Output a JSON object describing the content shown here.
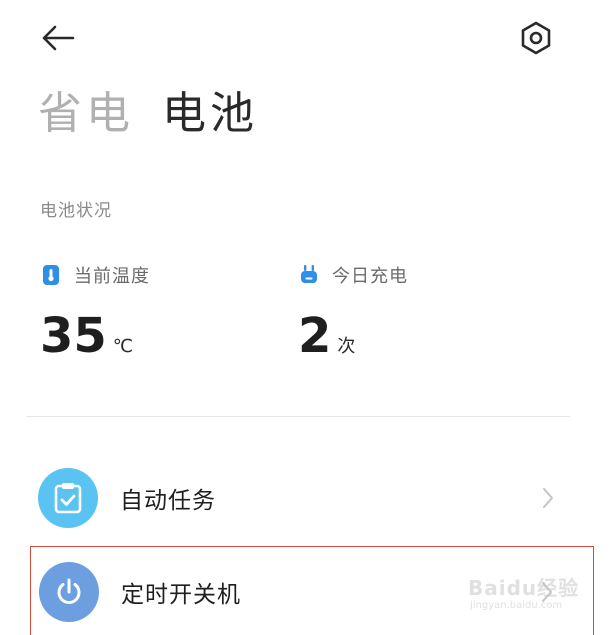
{
  "header": {
    "back_icon": "arrow-left-icon",
    "settings_icon": "hexagon-gear-icon"
  },
  "tabs": [
    {
      "label": "省电",
      "active": false
    },
    {
      "label": "电池",
      "active": true
    }
  ],
  "battery_status": {
    "section_title": "电池状况",
    "temperature": {
      "label": "当前温度",
      "value": "35",
      "unit": "℃",
      "icon": "thermometer-icon",
      "icon_color": "#2f8fe8"
    },
    "charges_today": {
      "label": "今日充电",
      "value": "2",
      "unit": "次",
      "icon": "plug-icon",
      "icon_color": "#2f8fe8"
    }
  },
  "menu": [
    {
      "label": "自动任务",
      "icon": "clipboard-check-icon",
      "icon_bg": "#5bc3f2"
    },
    {
      "label": "定时开关机",
      "icon": "power-icon",
      "icon_bg": "#6d9fe0"
    }
  ],
  "watermark": {
    "text": "Baidu经验",
    "sub": "jingyan.baidu.com"
  },
  "colors": {
    "highlight_border": "#d24a3c",
    "inactive_tab": "#b0b0b0",
    "active_tab": "#2a2a2a"
  }
}
